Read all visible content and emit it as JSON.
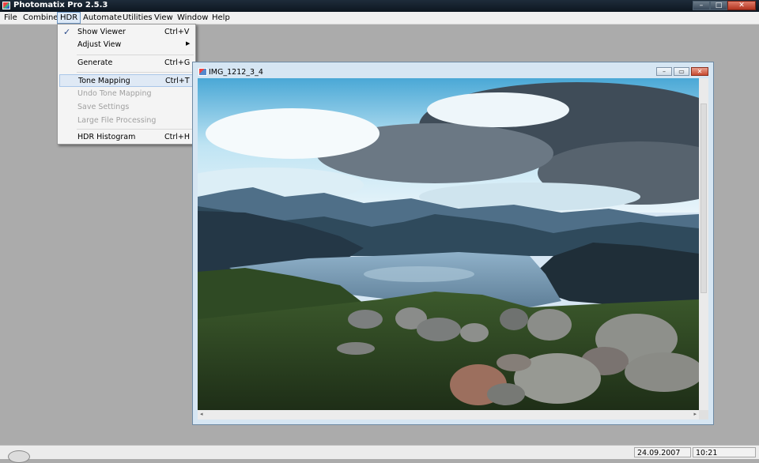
{
  "app": {
    "title": "Photomatix Pro 2.5.3"
  },
  "window_controls": {
    "minimize": "–",
    "maximize": "□",
    "close": "✕"
  },
  "menu": [
    "File",
    "Combine",
    "HDR",
    "Automate",
    "Utilities",
    "View",
    "Window",
    "Help"
  ],
  "active_menu": "HDR",
  "hdr_menu": {
    "show_viewer": {
      "label": "Show Viewer",
      "shortcut": "Ctrl+V",
      "checked": true
    },
    "adjust_view": {
      "label": "Adjust View",
      "submenu": true
    },
    "generate": {
      "label": "Generate",
      "shortcut": "Ctrl+G"
    },
    "tone_mapping": {
      "label": "Tone Mapping",
      "shortcut": "Ctrl+T",
      "highlighted": true
    },
    "undo_tone_mapping": {
      "label": "Undo Tone Mapping",
      "disabled": true
    },
    "save_settings": {
      "label": "Save Settings",
      "disabled": true
    },
    "large_file_processing": {
      "label": "Large File Processing",
      "disabled": true
    },
    "hdr_histogram": {
      "label": "HDR Histogram",
      "shortcut": "Ctrl+H"
    }
  },
  "image_window": {
    "title": "IMG_1212_3_4",
    "controls": {
      "minimize": "–",
      "maximize": "▭",
      "close": "✕"
    }
  },
  "status": {
    "date": "24.09.2007",
    "time": "10:21"
  },
  "icons": {
    "check": "✓",
    "submenu_arrow": "▶",
    "scroll_left": "◂",
    "scroll_right": "▸"
  }
}
